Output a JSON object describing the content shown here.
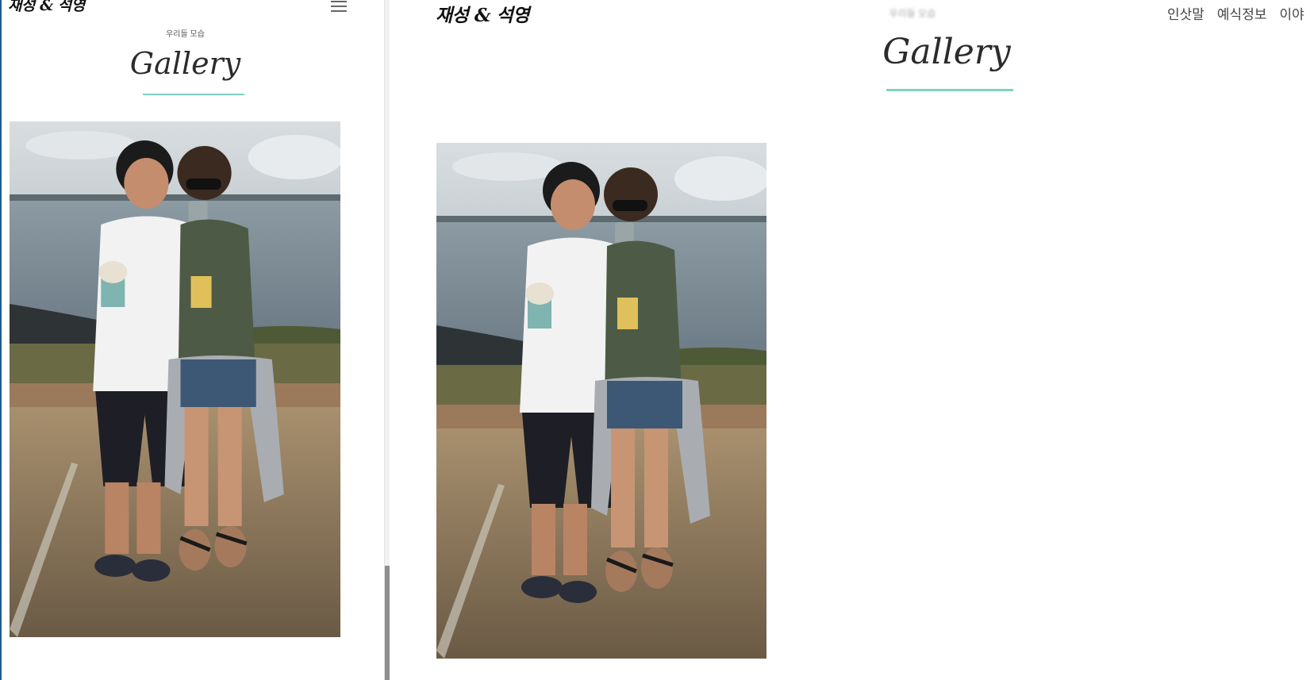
{
  "mobile": {
    "logo": "재성 & 석영",
    "menu_icon": "hamburger-menu-icon",
    "eyebrow": "우리들 모습",
    "title": "Gallery",
    "photo_icon": "couple-photo"
  },
  "desktop": {
    "logo": "재성 & 석영",
    "eyebrow": "우리들 모습",
    "title": "Gallery",
    "nav": [
      "인삿말",
      "예식정보",
      "이야"
    ],
    "photo_icon": "couple-photo"
  },
  "colors": {
    "accent_line": "#7ed3c0",
    "scroll_thumb": "#8f8f8f",
    "left_border": "#1f5d8a"
  }
}
